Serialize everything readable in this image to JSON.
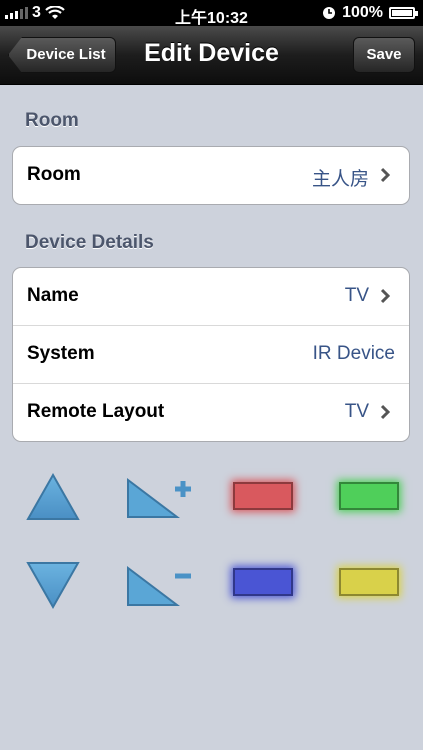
{
  "status_bar": {
    "carrier": "3",
    "time": "上午10:32",
    "battery": "100%"
  },
  "nav": {
    "back_label": "Device List",
    "title": "Edit Device",
    "save_label": "Save"
  },
  "room_section": {
    "header": "Room",
    "row": {
      "label": "Room",
      "value": "主人房"
    }
  },
  "details_section": {
    "header": "Device Details",
    "rows": [
      {
        "label": "Name",
        "value": "TV"
      },
      {
        "label": "System",
        "value": "IR Device"
      },
      {
        "label": "Remote Layout",
        "value": "TV"
      }
    ]
  },
  "controls": {
    "colors": {
      "red": "#d9595e",
      "green": "#4fcf5a",
      "blue": "#4a55d4",
      "yellow": "#d9d14a",
      "triangle": "#5aa6d6"
    }
  }
}
